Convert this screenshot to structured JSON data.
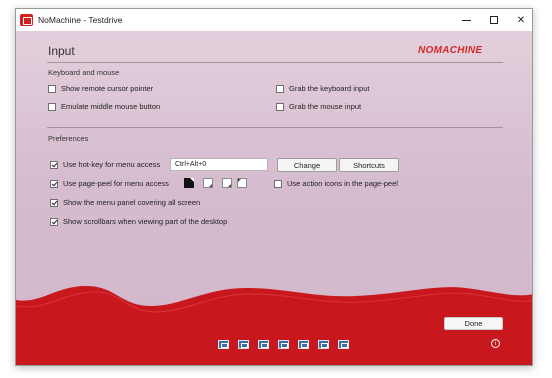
{
  "window": {
    "title": "NoMachine - Testdrive",
    "controls": {
      "minimize": "minimize-icon",
      "maximize": "maximize-icon",
      "close": "✕"
    }
  },
  "page": {
    "title": "Input",
    "brand": "NOMACHINE"
  },
  "keyboard_mouse": {
    "label": "Keyboard and mouse",
    "options": [
      {
        "label": "Show remote cursor pointer",
        "checked": false
      },
      {
        "label": "Emulate middle mouse button",
        "checked": false
      },
      {
        "label": "Grab the keyboard input",
        "checked": false
      },
      {
        "label": "Grab the mouse input",
        "checked": false
      }
    ]
  },
  "preferences": {
    "label": "Preferences",
    "hotkey": {
      "label": "Use hot-key for menu access",
      "checked": true,
      "value": "Ctrl+Alt+0"
    },
    "change_button": "Change",
    "shortcuts_button": "Shortcuts",
    "page_peel": {
      "label": "Use page-peel for menu access",
      "checked": true
    },
    "action_icons": {
      "label": "Use action icons in the page-peel",
      "checked": false
    },
    "menu_panel": {
      "label": "Show the menu panel covering all screen",
      "checked": true
    },
    "scrollbars": {
      "label": "Show scrollbars when viewing part of the desktop",
      "checked": true
    }
  },
  "footer": {
    "done_button": "Done",
    "info_icon": "i",
    "toolbar_icons": [
      "display-icon",
      "fullscreen-icon",
      "keyboard-icon",
      "resize-icon",
      "audio-icon",
      "screen-icon",
      "recording-icon"
    ]
  },
  "colors": {
    "brand_red": "#d42a2a",
    "wave_red": "#c8181d",
    "background": "#d7bfd0"
  }
}
